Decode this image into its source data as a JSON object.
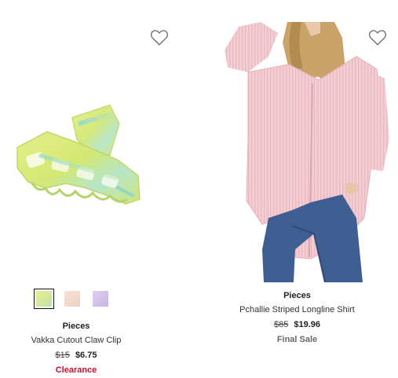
{
  "products": [
    {
      "brand": "Pieces",
      "name": "Vakka Cutout Claw Clip",
      "original_price": "$15",
      "sale_price": "$6.75",
      "badge": "Clearance",
      "badge_color": "#c8102e",
      "favorite_icon": "heart-outline-icon",
      "swatches": [
        {
          "color": "#d9e37a",
          "selected": true
        },
        {
          "color": "#f1d8cc",
          "selected": false
        },
        {
          "color": "#d6c2e8",
          "selected": false
        }
      ]
    },
    {
      "brand": "Pieces",
      "name": "Pchallie Striped Longline Shirt",
      "original_price": "$85",
      "sale_price": "$19.96",
      "badge": "Final Sale",
      "badge_color": "#666666",
      "favorite_icon": "heart-outline-icon"
    }
  ]
}
